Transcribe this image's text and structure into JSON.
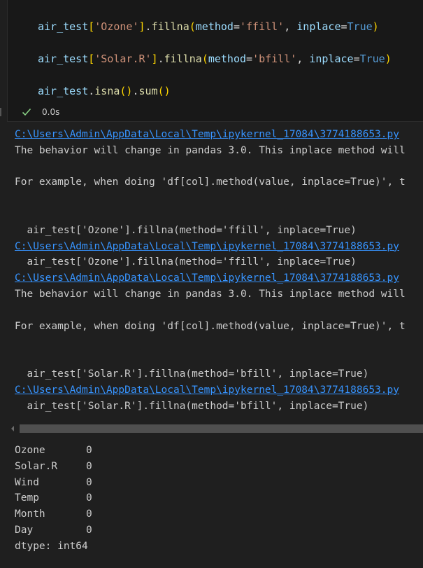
{
  "code": {
    "line1": {
      "var": "air_test",
      "b1": "[",
      "key": "'Ozone'",
      "b2": "]",
      "dot_fn": ".fillna",
      "fn": "fillna",
      "p_open": "(",
      "kw": "method",
      "eq": "=",
      "val": "'ffill'",
      "comma": ", ",
      "kw2": "inplace",
      "eq2": "=",
      "bool": "True",
      "p_close": ")"
    },
    "line2": {
      "var": "air_test",
      "b1": "[",
      "key": "'Solar.R'",
      "b2": "]",
      "fn": "fillna",
      "p_open": "(",
      "kw": "method",
      "eq": "=",
      "val": "'bfill'",
      "comma": ", ",
      "kw2": "inplace",
      "eq2": "=",
      "bool": "True",
      "p_close": ")"
    },
    "line3": {
      "var": "air_test",
      "fn1": "isna",
      "fn2": "sum",
      "parens": "()"
    }
  },
  "status": {
    "icon": "check-icon",
    "time": "0.0s",
    "success_color": "#89d185"
  },
  "output": {
    "lines": [
      {
        "type": "link",
        "text": "C:\\Users\\Admin\\AppData\\Local\\Temp\\ipykernel_17084\\3774188653.py"
      },
      {
        "type": "text",
        "text": "The behavior will change in pandas 3.0. This inplace method will"
      },
      {
        "type": "text",
        "text": ""
      },
      {
        "type": "text",
        "text": "For example, when doing 'df[col].method(value, inplace=True)', t"
      },
      {
        "type": "text",
        "text": ""
      },
      {
        "type": "text",
        "text": ""
      },
      {
        "type": "text",
        "text": "  air_test['Ozone'].fillna(method='ffill', inplace=True)"
      },
      {
        "type": "link",
        "text": "C:\\Users\\Admin\\AppData\\Local\\Temp\\ipykernel_17084\\3774188653.py"
      },
      {
        "type": "text",
        "text": "  air_test['Ozone'].fillna(method='ffill', inplace=True)"
      },
      {
        "type": "link",
        "text": "C:\\Users\\Admin\\AppData\\Local\\Temp\\ipykernel_17084\\3774188653.py"
      },
      {
        "type": "text",
        "text": "The behavior will change in pandas 3.0. This inplace method will"
      },
      {
        "type": "text",
        "text": ""
      },
      {
        "type": "text",
        "text": "For example, when doing 'df[col].method(value, inplace=True)', t"
      },
      {
        "type": "text",
        "text": ""
      },
      {
        "type": "text",
        "text": ""
      },
      {
        "type": "text",
        "text": "  air_test['Solar.R'].fillna(method='bfill', inplace=True)"
      },
      {
        "type": "link",
        "text": "C:\\Users\\Admin\\AppData\\Local\\Temp\\ipykernel_17084\\3774188653.py"
      },
      {
        "type": "text",
        "text": "  air_test['Solar.R'].fillna(method='bfill', inplace=True)"
      }
    ],
    "series": [
      {
        "name": "Ozone",
        "value": "0"
      },
      {
        "name": "Solar.R",
        "value": "0"
      },
      {
        "name": "Wind",
        "value": "0"
      },
      {
        "name": "Temp",
        "value": "0"
      },
      {
        "name": "Month",
        "value": "0"
      },
      {
        "name": "Day",
        "value": "0"
      }
    ],
    "dtype": "dtype: int64"
  }
}
